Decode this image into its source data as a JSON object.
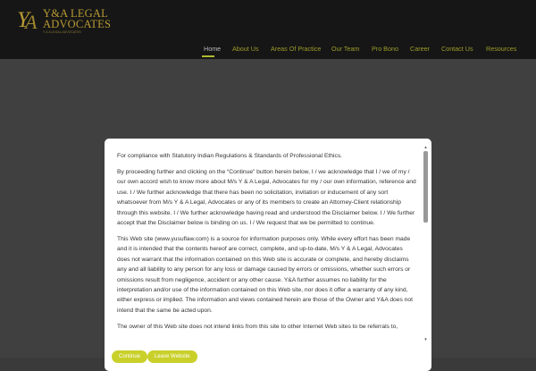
{
  "header": {
    "logo": {
      "mark": "Y&A",
      "line1": "Y&A LEGAL",
      "line2": "ADVOCATES",
      "tagline": "Y & A LEGAL ADVOCATES"
    },
    "nav": [
      {
        "label": "Home",
        "active": true
      },
      {
        "label": "About Us"
      },
      {
        "label": "Areas Of Practice"
      },
      {
        "label": "Our Team"
      },
      {
        "label": "Pro Bono"
      },
      {
        "label": "Career"
      },
      {
        "label": "Contact Us"
      },
      {
        "label": "Resources"
      }
    ]
  },
  "modal": {
    "paragraphs": [
      "For compliance with Statutory Indian Regulations & Standards of Professional Ethics.",
      "By proceeding further and clicking on the “Continue” button herein below, I / we acknowledge that I / we of my / our own accord wish to know more about M/s Y & A Legal, Advocates for my / our own information, reference and use. I / We further acknowledge that there has been no solicitation, invitation or inducement of any sort whatsoever from M/s Y & A Legal, Advocates or any of its members to create an Attorney-Client relationship through this website. I / We further acknowledge having read and understood the Disclaimer below. I / We further accept that the Disclaimer below is binding on us. I / We request that we be permitted to continue.",
      "This Web site (www.yusuflaw.com) is a source for information purposes only. While every effort has been made and it is intended that the contents hereof are correct, complete, and up-to-date, M/s Y & A Legal, Advocates does not warrant that the information contained on this Web site is accurate or complete, and hereby disclaims any and all liability to any person for any loss or damage caused by errors or omissions, whether such errors or omissions result from negligence, accident or any other cause. Y&A further assumes no liability for the interpretation and/or use of the information contained on this Web site, nor does it offer a warranty of any kind, either express or implied. The information and views contained herein are those of the Owner and Y&A does not intend that the same be acted upon.",
      "The owner of this Web site does not intend links from this site to other Internet Web sites to be referrals to,"
    ],
    "buttons": {
      "continue": "Continue",
      "leave": "Leave Website"
    }
  },
  "colors": {
    "accent": "#c9d02a",
    "logo_gold": "#b89b34",
    "header_bg": "#161616",
    "overlay": "#404040"
  }
}
